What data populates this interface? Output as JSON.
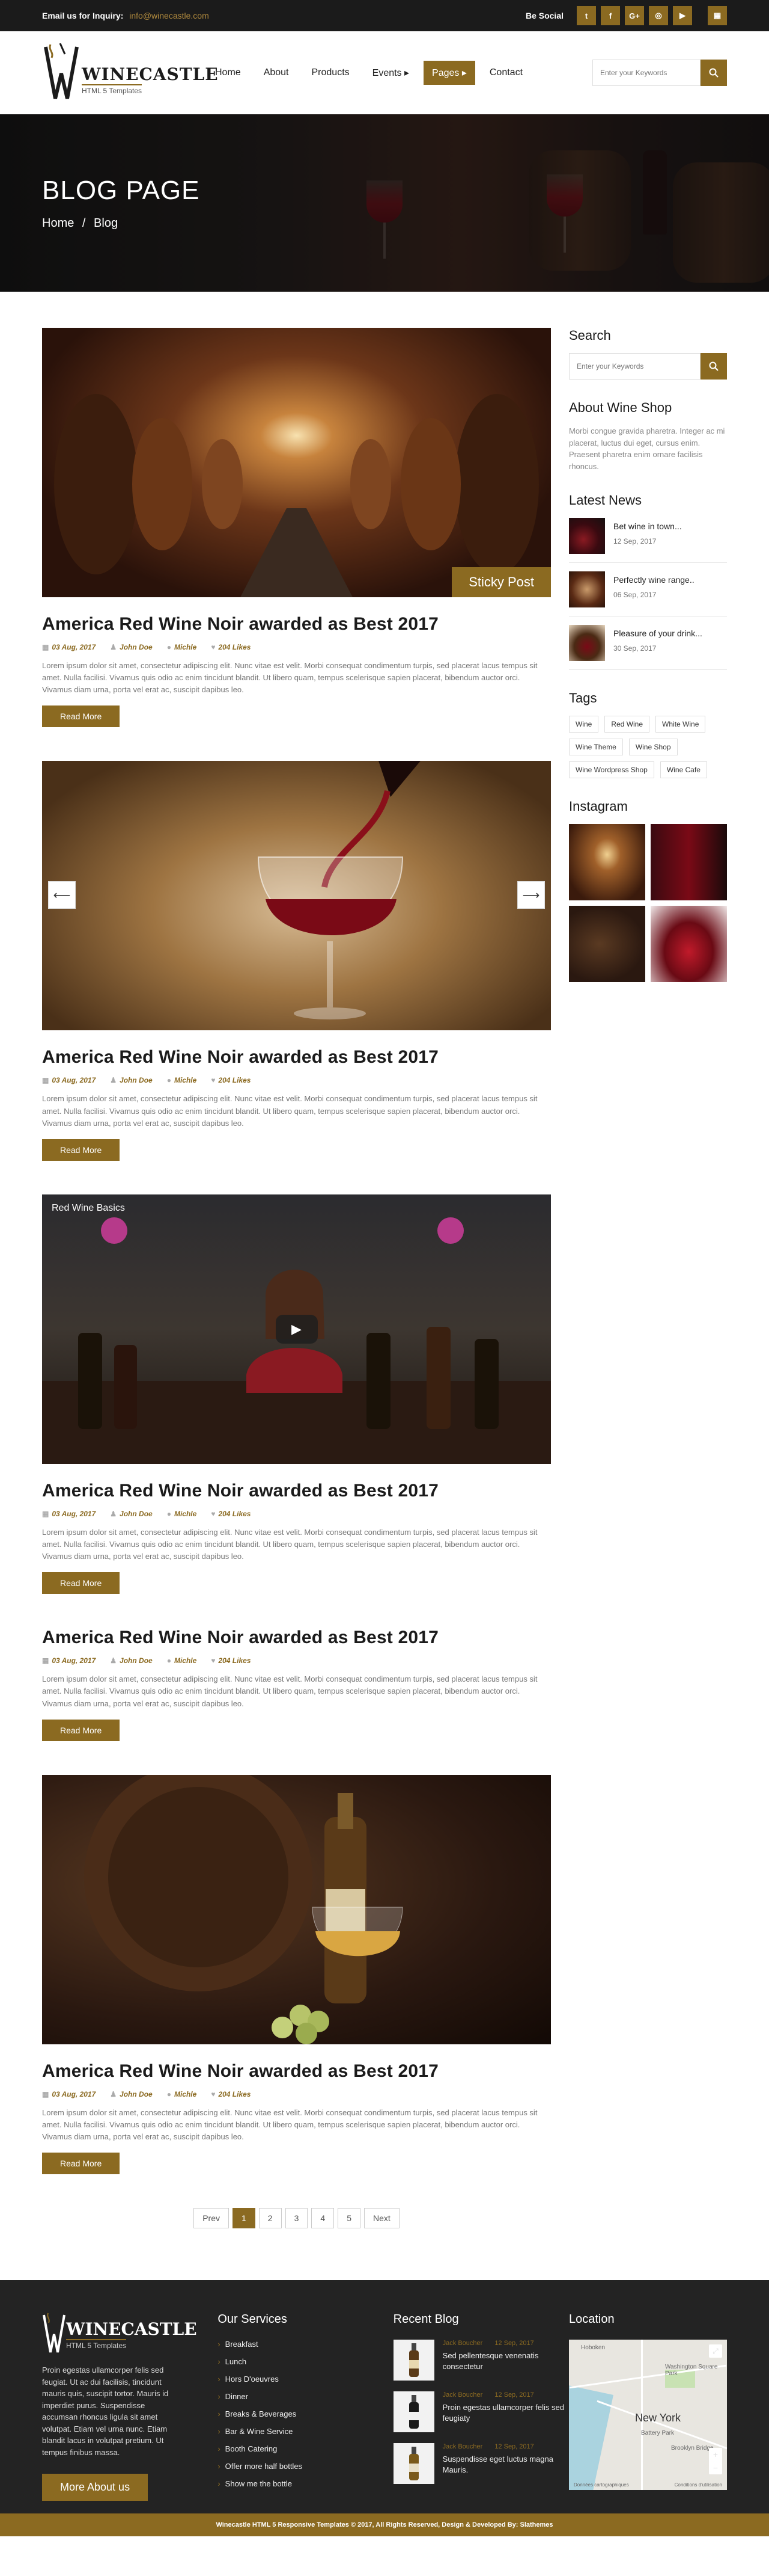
{
  "topbar": {
    "inquiry_label": "Email us for Inquiry:",
    "inquiry_email": "info@winecastle.com",
    "social_label": "Be Social",
    "social_icons": [
      "twitter-icon",
      "facebook-icon",
      "google-plus-icon",
      "instagram-icon",
      "youtube-icon",
      "calendar-icon"
    ],
    "social_glyphs": [
      "t",
      "f",
      "G+",
      "◎",
      "▶",
      "▦"
    ]
  },
  "header": {
    "logo_big": "WINECASTLE",
    "logo_sub": "HTML 5 Templates",
    "nav": [
      {
        "label": "Home",
        "active": false
      },
      {
        "label": "About",
        "active": false
      },
      {
        "label": "Products",
        "active": false
      },
      {
        "label": "Events ▸",
        "active": false
      },
      {
        "label": "Pages ▸",
        "active": true
      },
      {
        "label": "Contact",
        "active": false
      }
    ],
    "search_placeholder": "Enter your Keywords"
  },
  "banner": {
    "title": "BLOG PAGE",
    "crumb_home": "Home",
    "crumb_sep": "/",
    "crumb_current": "Blog"
  },
  "posts": [
    {
      "media": "cellar",
      "sticky": "Sticky Post",
      "title": "America Red Wine Noir awarded as Best 2017",
      "date": "03 Aug, 2017",
      "author": "John Doe",
      "category": "Michle",
      "likes": "204 Likes",
      "body": "Lorem ipsum dolor sit amet, consectetur adipiscing elit. Nunc vitae est velit. Morbi consequat condimentum turpis, sed placerat lacus tempus sit amet. Nulla facilisi. Vivamus quis odio ac enim tincidunt blandit. Ut libero quam, tempus scelerisque sapien placerat, bibendum auctor orci. Vivamus diam urna, porta vel erat ac, suscipit dapibus leo.",
      "read_more": "Read More"
    },
    {
      "media": "wine",
      "title": "America Red Wine Noir awarded as Best 2017",
      "date": "03 Aug, 2017",
      "author": "John Doe",
      "category": "Michle",
      "likes": "204 Likes",
      "body": "Lorem ipsum dolor sit amet, consectetur adipiscing elit. Nunc vitae est velit. Morbi consequat condimentum turpis, sed placerat lacus tempus sit amet. Nulla facilisi. Vivamus quis odio ac enim tincidunt blandit. Ut libero quam, tempus scelerisque sapien placerat, bibendum auctor orci. Vivamus diam urna, porta vel erat ac, suscipit dapibus leo.",
      "read_more": "Read More"
    },
    {
      "media": "video",
      "video_title": "Red Wine Basics",
      "title": "America Red Wine Noir awarded as Best 2017",
      "date": "03 Aug, 2017",
      "author": "John Doe",
      "category": "Michle",
      "likes": "204 Likes",
      "body": "Lorem ipsum dolor sit amet, consectetur adipiscing elit. Nunc vitae est velit. Morbi consequat condimentum turpis, sed placerat lacus tempus sit amet. Nulla facilisi. Vivamus quis odio ac enim tincidunt blandit. Ut libero quam, tempus scelerisque sapien placerat, bibendum auctor orci. Vivamus diam urna, porta vel erat ac, suscipit dapibus leo.",
      "read_more": "Read More"
    },
    {
      "media": "none",
      "title": "America Red Wine Noir awarded as Best 2017",
      "date": "03 Aug, 2017",
      "author": "John Doe",
      "category": "Michle",
      "likes": "204 Likes",
      "body": "Lorem ipsum dolor sit amet, consectetur adipiscing elit. Nunc vitae est velit. Morbi consequat condimentum turpis, sed placerat lacus tempus sit amet. Nulla facilisi. Vivamus quis odio ac enim tincidunt blandit. Ut libero quam, tempus scelerisque sapien placerat, bibendum auctor orci. Vivamus diam urna, porta vel erat ac, suscipit dapibus leo.",
      "read_more": "Read More"
    },
    {
      "media": "barrel",
      "title": "America Red Wine Noir awarded as Best 2017",
      "date": "03 Aug, 2017",
      "author": "John Doe",
      "category": "Michle",
      "likes": "204 Likes",
      "body": "Lorem ipsum dolor sit amet, consectetur adipiscing elit. Nunc vitae est velit. Morbi consequat condimentum turpis, sed placerat lacus tempus sit amet. Nulla facilisi. Vivamus quis odio ac enim tincidunt blandit. Ut libero quam, tempus scelerisque sapien placerat, bibendum auctor orci. Vivamus diam urna, porta vel erat ac, suscipit dapibus leo.",
      "read_more": "Read More"
    }
  ],
  "pagination": [
    "Prev",
    "1",
    "2",
    "3",
    "4",
    "5",
    "Next"
  ],
  "pagination_active": "1",
  "sidebar": {
    "search_title": "Search",
    "search_placeholder": "Enter your Keywords",
    "about_title": "About Wine Shop",
    "about_text": "Morbi congue gravida pharetra. Integer ac mi placerat, luctus dui eget, cursus enim. Praesent pharetra enim ornare facilisis rhoncus.",
    "news_title": "Latest News",
    "news": [
      {
        "title": "Bet wine in town...",
        "date": "12 Sep, 2017"
      },
      {
        "title": "Perfectly wine range..",
        "date": "06 Sep, 2017"
      },
      {
        "title": "Pleasure of your drink...",
        "date": "30 Sep, 2017"
      }
    ],
    "tags_title": "Tags",
    "tags": [
      "Wine",
      "Red Wine",
      "White Wine",
      "Wine Theme",
      "Wine Shop",
      "Wine Wordpress Shop",
      "Wine Cafe"
    ],
    "instagram_title": "Instagram"
  },
  "footer": {
    "logo_big": "WINECASTLE",
    "logo_sub": "HTML 5 Templates",
    "about": "Proin egestas ullamcorper felis sed feugiat. Ut ac dui facilisis, tincidunt mauris quis, suscipit tortor. Mauris id imperdiet purus. Suspendisse accumsan rhoncus ligula sit amet volutpat. Etiam vel urna nunc. Etiam blandit lacus in volutpat pretium. Ut tempus finibus massa.",
    "more_label": "More About us",
    "services_title": "Our Services",
    "services": [
      "Breakfast",
      "Lunch",
      "Hors D'oeuvres",
      "Dinner",
      "Breaks & Beverages",
      "Bar & Wine Service",
      "Booth Catering",
      "Offer more half bottles",
      "Show me the bottle"
    ],
    "blog_title": "Recent Blog",
    "blog": [
      {
        "author": "Jack Boucher",
        "date": "12 Sep, 2017",
        "text": "Sed pellentesque venenatis consectetur"
      },
      {
        "author": "Jack Boucher",
        "date": "12 Sep, 2017",
        "text": "Proin egestas ullamcorper felis sed feugiaty"
      },
      {
        "author": "Jack Boucher",
        "date": "12 Sep, 2017",
        "text": "Suspendisse eget luctus magna Mauris."
      }
    ],
    "location_title": "Location",
    "map": {
      "city": "New York",
      "labels": [
        "Hoboken",
        "Washington Square Park",
        "Battery Park",
        "Brooklyn Bridge"
      ],
      "footer_left": "Données cartographiques",
      "footer_right": "Conditions d'utilisation"
    },
    "copyright": "Winecastle HTML 5 Responsive Templates © 2017, All Rights Reserved, Design & Developed By: Slathemes"
  },
  "colors": {
    "accent": "#8b6a21",
    "dark": "#1b1b1b",
    "footer": "#232323"
  }
}
